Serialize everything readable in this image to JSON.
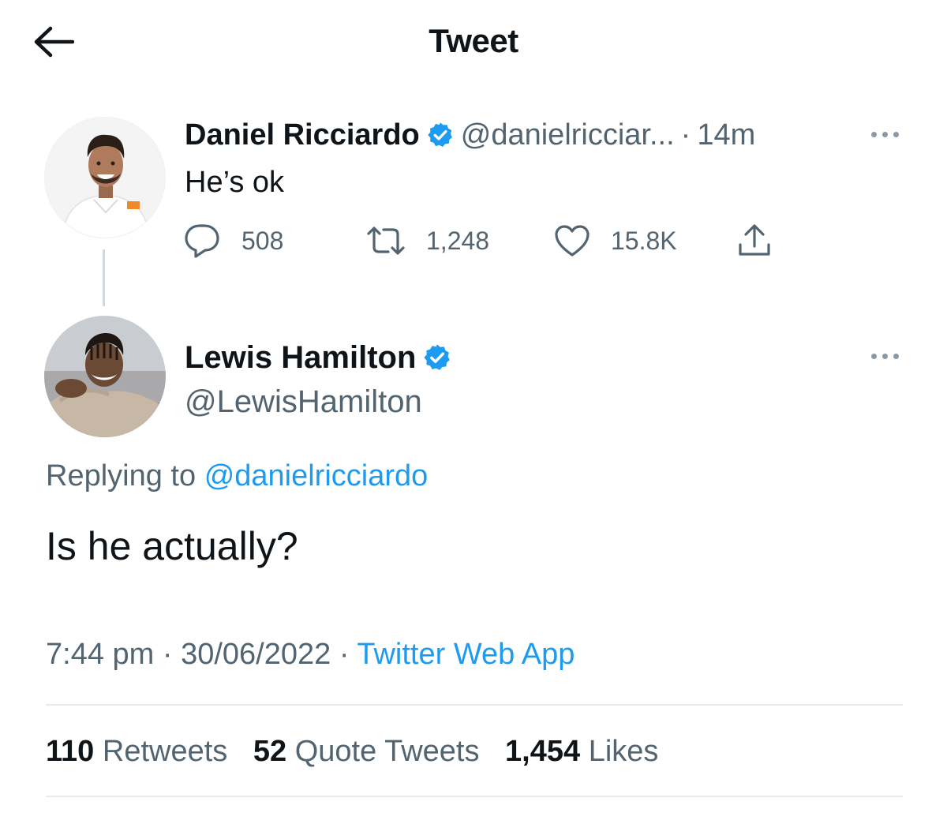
{
  "header": {
    "title": "Tweet",
    "back_icon": "arrow-left-icon"
  },
  "colors": {
    "accent": "#1d9bf0",
    "secondary_text": "#536471",
    "primary_text": "#0f1419"
  },
  "parent_tweet": {
    "author_name": "Daniel Ricciardo",
    "handle": "@danielricciar...",
    "separator": "·",
    "time": "14m",
    "text": "He’s ok",
    "actions": {
      "reply_count": "508",
      "retweet_count": "1,248",
      "like_count": "15.8K"
    }
  },
  "main_tweet": {
    "author_name": "Lewis Hamilton",
    "handle": "@LewisHamilton",
    "replying_prefix": "Replying to",
    "replying_handle": "@danielricciardo",
    "text": "Is he actually?",
    "time": "7:44 pm",
    "sep1": "·",
    "date": "30/06/2022",
    "sep2": "·",
    "source": "Twitter Web App"
  },
  "stats": {
    "retweets_count": "110",
    "retweets_label": "Retweets",
    "quotes_count": "52",
    "quotes_label": "Quote Tweets",
    "likes_count": "1,454",
    "likes_label": "Likes"
  }
}
